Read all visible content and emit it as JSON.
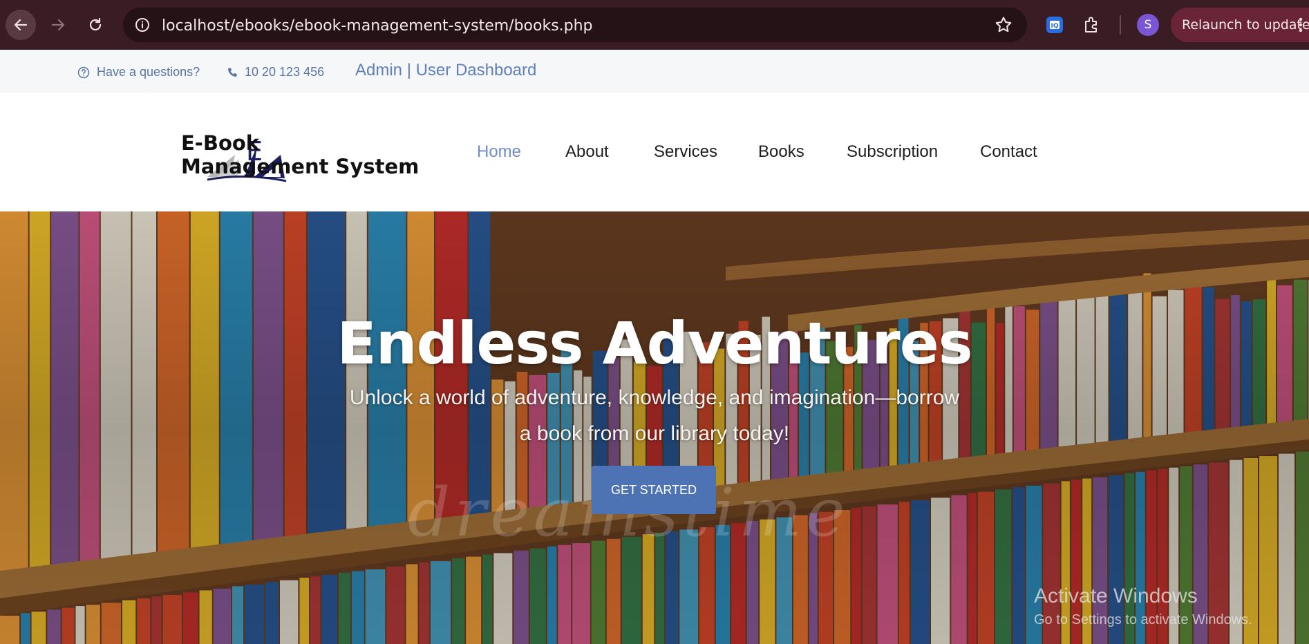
{
  "browser": {
    "url_host": "localhost",
    "url_path": "/ebooks/ebook-management-system/books.php",
    "profile_initial": "S",
    "relaunch_label": "Relaunch to update",
    "icons": [
      "back-arrow-icon",
      "forward-arrow-icon",
      "reload-icon",
      "site-info-icon",
      "bookmark-star-icon",
      "extension-icon",
      "puzzle-icon",
      "kebab-menu-icon"
    ]
  },
  "topbar": {
    "question_text": "Have a questions?",
    "phone_text": "10 20 123 456",
    "dashboard_link": "Admin | User Dashboard"
  },
  "header": {
    "logo_line1": "E-Book",
    "logo_line2": "Management System",
    "logo_letter": "E",
    "nav": [
      {
        "label": "Home",
        "active": true
      },
      {
        "label": "About",
        "active": false
      },
      {
        "label": "Services",
        "active": false
      },
      {
        "label": "Books",
        "active": false
      },
      {
        "label": "Subscription",
        "active": false
      },
      {
        "label": "Contact",
        "active": false
      }
    ]
  },
  "hero": {
    "title": "Endless Adventures",
    "subtitle_line1": "Unlock a world of adventure, knowledge, and imagination—borrow",
    "subtitle_line2": "a book from our library today!",
    "cta_label": "GET STARTED",
    "watermark": "dreamstime"
  },
  "os_overlay": {
    "line1": "Activate Windows",
    "line2": "Go to Settings to activate Windows."
  },
  "colors": {
    "chrome_bg": "#3a1d24",
    "accent": "#4e73b5",
    "nav_active": "#6e8ec5",
    "topbar_text": "#5a74a6"
  }
}
